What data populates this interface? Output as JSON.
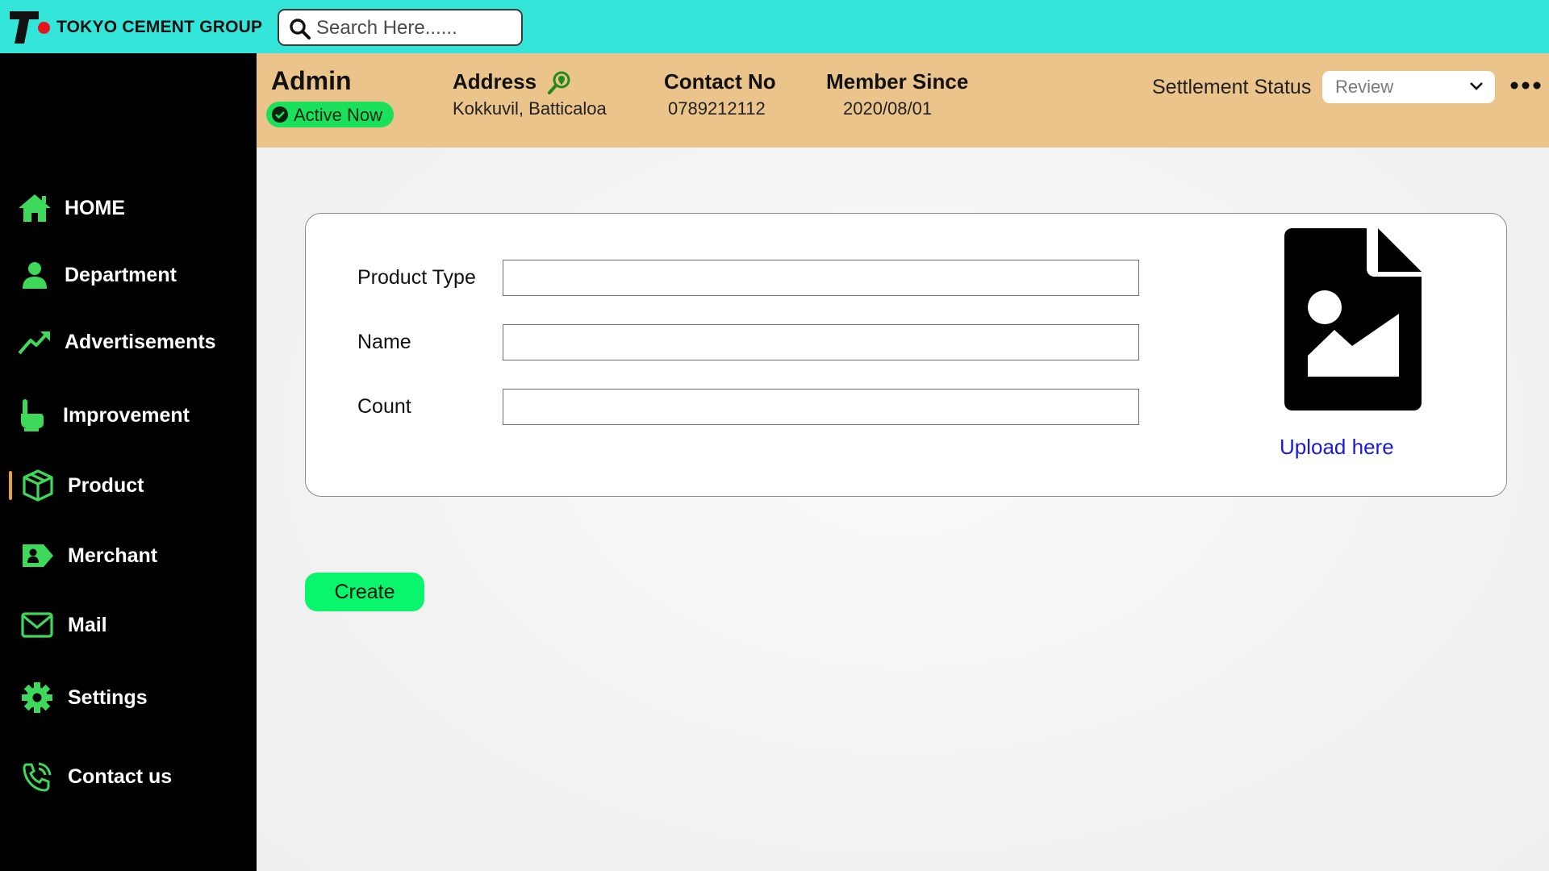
{
  "brand": {
    "name": "TOKYO CEMENT GROUP"
  },
  "search": {
    "placeholder": "Search Here......"
  },
  "sidebar": {
    "items": [
      {
        "label": "HOME",
        "icon": "home-icon"
      },
      {
        "label": "Department",
        "icon": "user-icon"
      },
      {
        "label": "Advertisements",
        "icon": "trend-arrow-icon"
      },
      {
        "label": "Improvement",
        "icon": "hand-pointer-icon"
      },
      {
        "label": "Product",
        "icon": "box-icon",
        "active": true
      },
      {
        "label": "Merchant",
        "icon": "merchant-tag-icon"
      },
      {
        "label": "Mail",
        "icon": "mail-icon"
      },
      {
        "label": "Settings",
        "icon": "gear-icon"
      },
      {
        "label": "Contact us",
        "icon": "phone-icon"
      }
    ]
  },
  "header": {
    "title": "Admin",
    "status": "Active Now",
    "address_label": "Address",
    "address_value": "Kokkuvil, Batticaloa",
    "contact_label": "Contact No",
    "contact_value": "0789212112",
    "member_label": "Member Since",
    "member_value": "2020/08/01",
    "settlement_label": "Settlement Status",
    "settlement_value": "Review"
  },
  "form": {
    "product_type_label": "Product Type",
    "name_label": "Name",
    "count_label": "Count",
    "product_type_value": "",
    "name_value": "",
    "count_value": "",
    "upload_label": "Upload here",
    "create_label": "Create"
  },
  "colors": {
    "topbar": "#33e6d9",
    "sidebar": "#000000",
    "info_bar": "#ebc48c",
    "accent_green": "#08f56c",
    "icon_green": "#3ed85a",
    "link_blue": "#1a1ad6"
  }
}
